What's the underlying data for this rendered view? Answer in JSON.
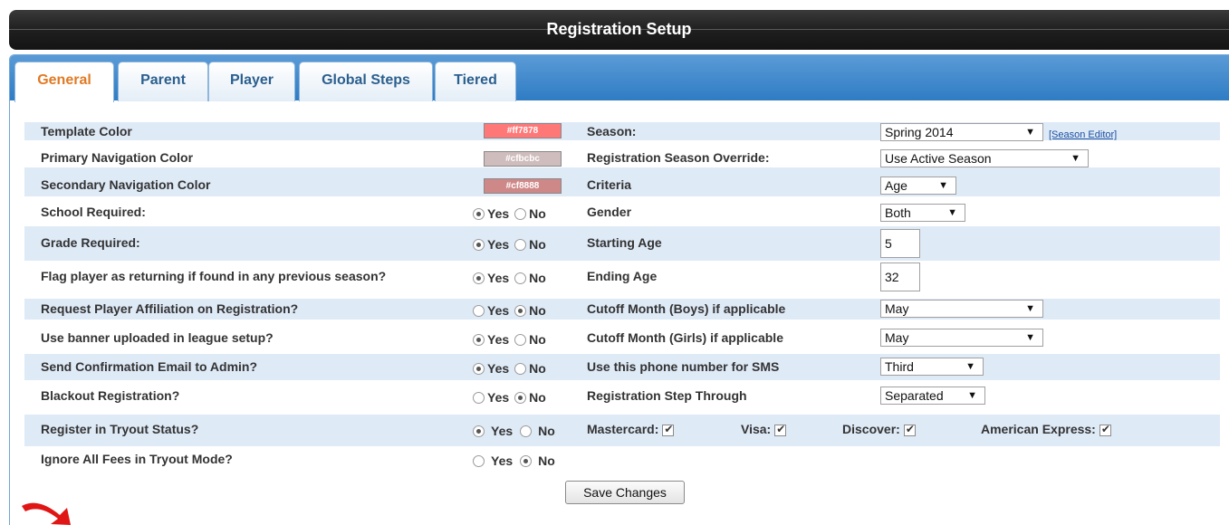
{
  "title": "Registration Setup",
  "tabs": [
    {
      "label": "General",
      "active": true
    },
    {
      "label": "Parent"
    },
    {
      "label": "Player"
    },
    {
      "label": "Global Steps"
    },
    {
      "label": "Tiered"
    }
  ],
  "colors": [
    {
      "label": "Template Color",
      "value": "#ff7878"
    },
    {
      "label": "Primary Navigation Color",
      "value": "#cfbcbc"
    },
    {
      "label": "Secondary Navigation Color",
      "value": "#cf8888"
    }
  ],
  "radio_options": {
    "yes": "Yes",
    "no": "No"
  },
  "left_settings": [
    {
      "label": "School Required:",
      "value": "Yes"
    },
    {
      "label": "Grade Required:",
      "value": "Yes"
    },
    {
      "label": "Flag player as returning if found in any previous season?",
      "value": "Yes"
    },
    {
      "label": "Request Player Affiliation on Registration?",
      "value": "No"
    },
    {
      "label": "Use banner uploaded in league setup?",
      "value": "Yes"
    },
    {
      "label": "Send Confirmation Email to Admin?",
      "value": "Yes"
    },
    {
      "label": "Blackout Registration?",
      "value": "No"
    },
    {
      "label": "Register in Tryout Status?",
      "value": "Yes"
    },
    {
      "label": "Ignore All Fees in Tryout Mode?",
      "value": "No"
    }
  ],
  "right_settings": [
    {
      "label": "Season:",
      "value": "Spring 2014",
      "type": "select"
    },
    {
      "label": "Registration Season Override:",
      "value": "Use Active Season",
      "type": "select"
    },
    {
      "label": "Criteria",
      "value": "Age",
      "type": "select"
    },
    {
      "label": "Gender",
      "value": "Both",
      "type": "select"
    },
    {
      "label": "Starting Age",
      "value": "5",
      "type": "text"
    },
    {
      "label": "Ending Age",
      "value": "32",
      "type": "text"
    },
    {
      "label": "Cutoff Month (Boys) if applicable",
      "value": "May",
      "type": "select"
    },
    {
      "label": "Cutoff Month (Girls) if applicable",
      "value": "May",
      "type": "select"
    },
    {
      "label": "Use this phone number for SMS",
      "value": "Third",
      "type": "select"
    },
    {
      "label": "Registration Step Through",
      "value": "Separated",
      "type": "select"
    }
  ],
  "season_editor_link": "[Season Editor]",
  "cards": [
    {
      "label": "Mastercard:",
      "checked": true
    },
    {
      "label": "Visa:",
      "checked": true
    },
    {
      "label": "Discover:",
      "checked": true
    },
    {
      "label": "American Express:",
      "checked": true
    }
  ],
  "save_label": "Save Changes"
}
